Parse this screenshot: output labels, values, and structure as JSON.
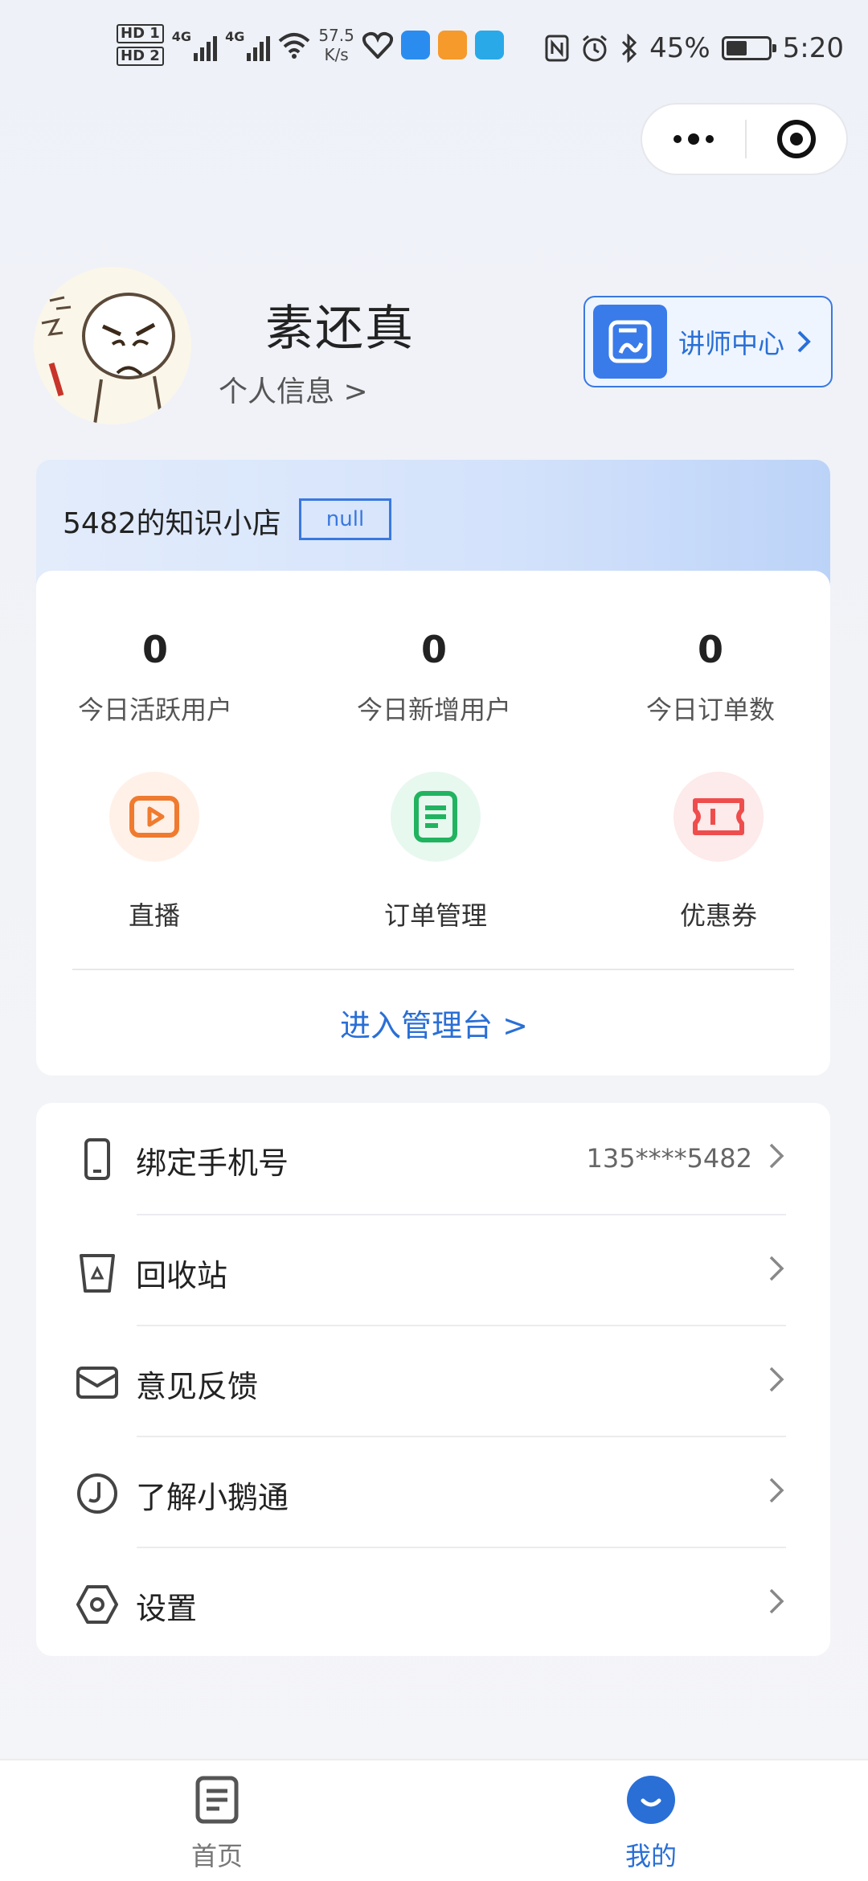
{
  "status_bar": {
    "hd1": "HD 1",
    "hd2": "HD 2",
    "sig1": "4G",
    "sig2": "4G",
    "net_speed_value": "57.5",
    "net_speed_unit": "K/s",
    "battery": "45%",
    "time": "5:20"
  },
  "profile": {
    "username": "素还真",
    "info_link": "个人信息 >",
    "lecturer_label": "讲师中心"
  },
  "shop": {
    "title": "5482的知识小店",
    "tag": "null",
    "stats": [
      {
        "value": "0",
        "label": "今日活跃用户"
      },
      {
        "value": "0",
        "label": "今日新增用户"
      },
      {
        "value": "0",
        "label": "今日订单数"
      }
    ],
    "functions": [
      {
        "label": "直播",
        "icon": "live-icon"
      },
      {
        "label": "订单管理",
        "icon": "order-icon"
      },
      {
        "label": "优惠券",
        "icon": "coupon-icon"
      }
    ],
    "admin_link": "进入管理台 >"
  },
  "menu": [
    {
      "label": "绑定手机号",
      "value": "135****5482",
      "icon": "phone-icon"
    },
    {
      "label": "回收站",
      "value": "",
      "icon": "recycle-bin-icon"
    },
    {
      "label": "意见反馈",
      "value": "",
      "icon": "mail-icon"
    },
    {
      "label": "了解小鹅通",
      "value": "",
      "icon": "goose-icon"
    },
    {
      "label": "设置",
      "value": "",
      "icon": "settings-icon"
    }
  ],
  "tabs": [
    {
      "label": "首页",
      "active": false
    },
    {
      "label": "我的",
      "active": true
    }
  ],
  "colors": {
    "accent": "#2a6fd6",
    "live": "#f07b2f",
    "order": "#21b35f",
    "coupon": "#ef4d4d"
  }
}
